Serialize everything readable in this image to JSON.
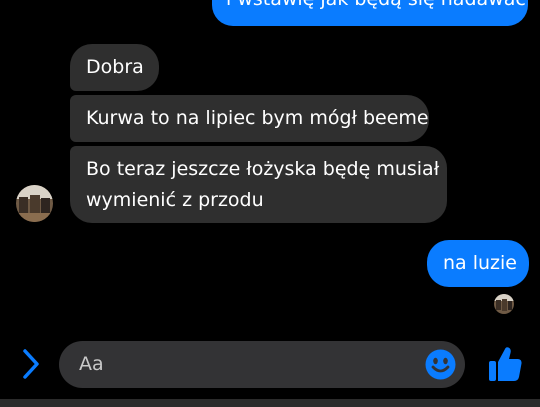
{
  "messages": {
    "outgoing_top": "i wstawię jak będą się nadawać",
    "incoming": [
      {
        "lines": [
          "Dobra"
        ]
      },
      {
        "lines": [
          "Kurwa to na lipiec bym mógł beeme"
        ]
      },
      {
        "lines": [
          "Bo teraz jeszcze łożyska będę musiał",
          "wymienić z przodu"
        ]
      }
    ],
    "outgoing_last": "na luzie"
  },
  "composer": {
    "placeholder": "Aa",
    "expand_icon": "chevron-right-icon",
    "emoji_icon": "smiley-icon",
    "like_icon": "thumbs-up-icon"
  },
  "colors": {
    "outgoing_bubble": "#0a7cff",
    "incoming_bubble": "#2f2f2f",
    "accent": "#0a7cff",
    "background": "#000000"
  }
}
